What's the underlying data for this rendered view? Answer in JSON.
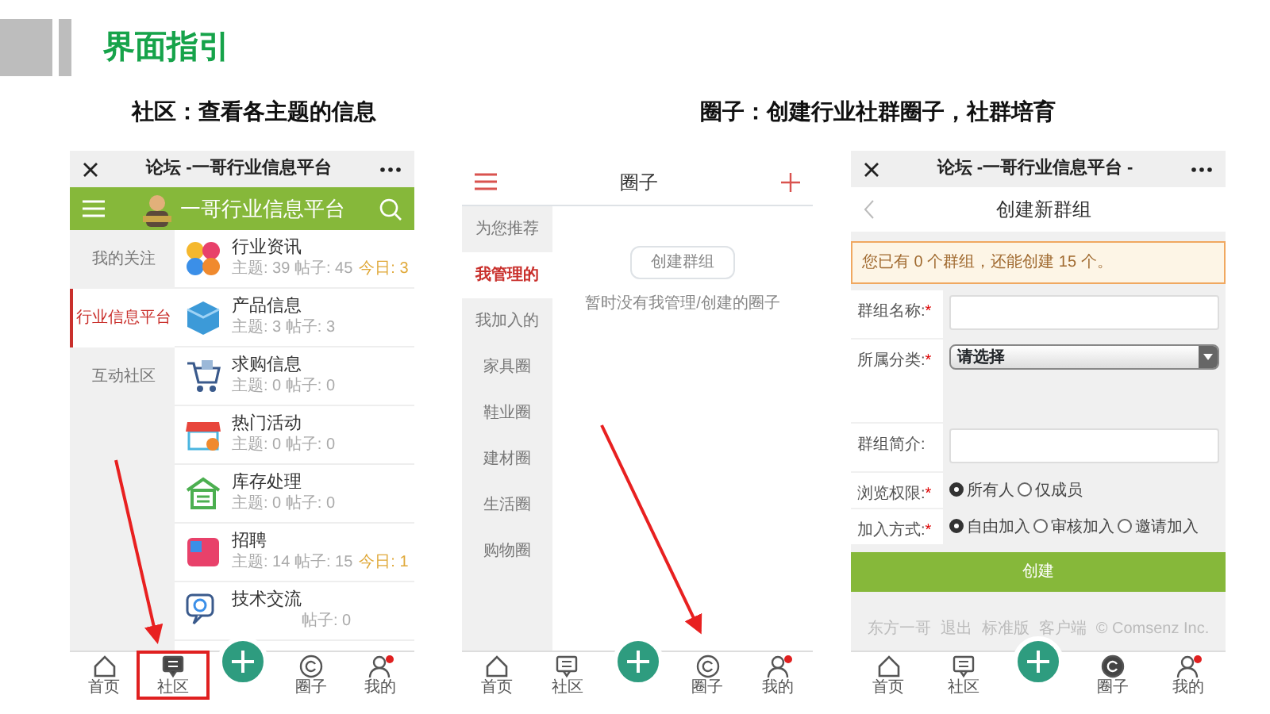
{
  "header": {
    "title": "界面指引"
  },
  "captions": [
    {
      "text": "社区：查看各主题的信息"
    },
    {
      "text": "圈子：创建行业社群圈子，社群培育"
    }
  ],
  "phones": [
    {
      "kind": "forum",
      "topbar": {
        "title": "论坛 -一哥行业信息平台"
      },
      "appbar": {
        "title": "一哥行业信息平台"
      },
      "sidebar": [
        {
          "label": "我的关注",
          "selected": false
        },
        {
          "label": "行业信息平台",
          "selected": true
        },
        {
          "label": "互动社区",
          "selected": false
        }
      ],
      "forums": [
        {
          "name": "行业资讯",
          "stats": "主题: 39  帖子: 45",
          "today": "今日: 3"
        },
        {
          "name": "产品信息",
          "stats": "主题: 3  帖子: 3"
        },
        {
          "name": "求购信息",
          "stats": "主题: 0  帖子: 0"
        },
        {
          "name": "热门活动",
          "stats": "主题: 0  帖子: 0"
        },
        {
          "name": "库存处理",
          "stats": "主题: 0  帖子: 0"
        },
        {
          "name": "招聘",
          "stats": "主题: 14  帖子: 15",
          "today": "今日: 1"
        },
        {
          "name": "技术交流",
          "stats": "帖子: 0"
        }
      ],
      "tabs": [
        {
          "kind": "tab",
          "label": "首页",
          "selected": false,
          "highlighted": false,
          "badge": false
        },
        {
          "kind": "tab",
          "label": "社区",
          "selected": true,
          "highlighted": true,
          "badge": false
        },
        {
          "kind": "add"
        },
        {
          "kind": "tab",
          "label": "圈子",
          "selected": false,
          "highlighted": false,
          "badge": false
        },
        {
          "kind": "tab",
          "label": "我的",
          "selected": false,
          "highlighted": false,
          "badge": true
        }
      ]
    },
    {
      "kind": "circles",
      "header": {
        "title": "圈子"
      },
      "sidebar": [
        {
          "label": "为您推荐",
          "selected": false
        },
        {
          "label": "我管理的",
          "selected": true
        },
        {
          "label": "我加入的",
          "selected": false
        },
        {
          "label": "家具圈",
          "selected": false
        },
        {
          "label": "鞋业圈",
          "selected": false
        },
        {
          "label": "建材圈",
          "selected": false
        },
        {
          "label": "生活圈",
          "selected": false
        },
        {
          "label": "购物圈",
          "selected": false
        }
      ],
      "create_button": "创建群组",
      "empty_text": "暂时没有我管理/创建的圈子",
      "tabs": [
        {
          "kind": "tab",
          "label": "首页",
          "selected": false,
          "highlighted": false,
          "badge": false
        },
        {
          "kind": "tab",
          "label": "社区",
          "selected": false,
          "highlighted": false,
          "badge": false
        },
        {
          "kind": "add"
        },
        {
          "kind": "tab",
          "label": "圈子",
          "selected": false,
          "highlighted": false,
          "badge": false
        },
        {
          "kind": "tab",
          "label": "我的",
          "selected": false,
          "highlighted": false,
          "badge": true
        }
      ]
    },
    {
      "kind": "create_group",
      "topbar": {
        "title": "论坛 -一哥行业信息平台 -"
      },
      "nav": {
        "title": "创建新群组"
      },
      "notice": "您已有 0 个群组，还能创建 15 个。",
      "fields": [
        {
          "kind": "text",
          "label": "群组名称:",
          "mark": "*"
        },
        {
          "kind": "select",
          "label": "所属分类:",
          "mark": "*",
          "value": "请选择"
        },
        {
          "kind": "textarea",
          "label": "群组简介:"
        },
        {
          "kind": "radios",
          "label": "浏览权限:",
          "mark": "*",
          "options": [
            {
              "label": "所有人",
              "selected": true
            },
            {
              "label": "仅成员",
              "selected": false
            }
          ]
        },
        {
          "kind": "radios",
          "label": "加入方式:",
          "mark": "*",
          "options": [
            {
              "label": "自由加入",
              "selected": true
            },
            {
              "label": "审核加入",
              "selected": false
            },
            {
              "label": "邀请加入",
              "selected": false
            }
          ]
        }
      ],
      "submit": "创建",
      "footer": [
        "东方一哥",
        "退出",
        "标准版",
        "客户端",
        "© Comsenz Inc."
      ],
      "tabs": [
        {
          "kind": "tab",
          "label": "首页",
          "selected": false,
          "highlighted": false,
          "badge": false
        },
        {
          "kind": "tab",
          "label": "社区",
          "selected": false,
          "highlighted": false,
          "badge": false
        },
        {
          "kind": "add"
        },
        {
          "kind": "tab",
          "label": "圈子",
          "selected": true,
          "highlighted": false,
          "badge": false
        },
        {
          "kind": "tab",
          "label": "我的",
          "selected": false,
          "highlighted": false,
          "badge": true
        }
      ]
    }
  ]
}
